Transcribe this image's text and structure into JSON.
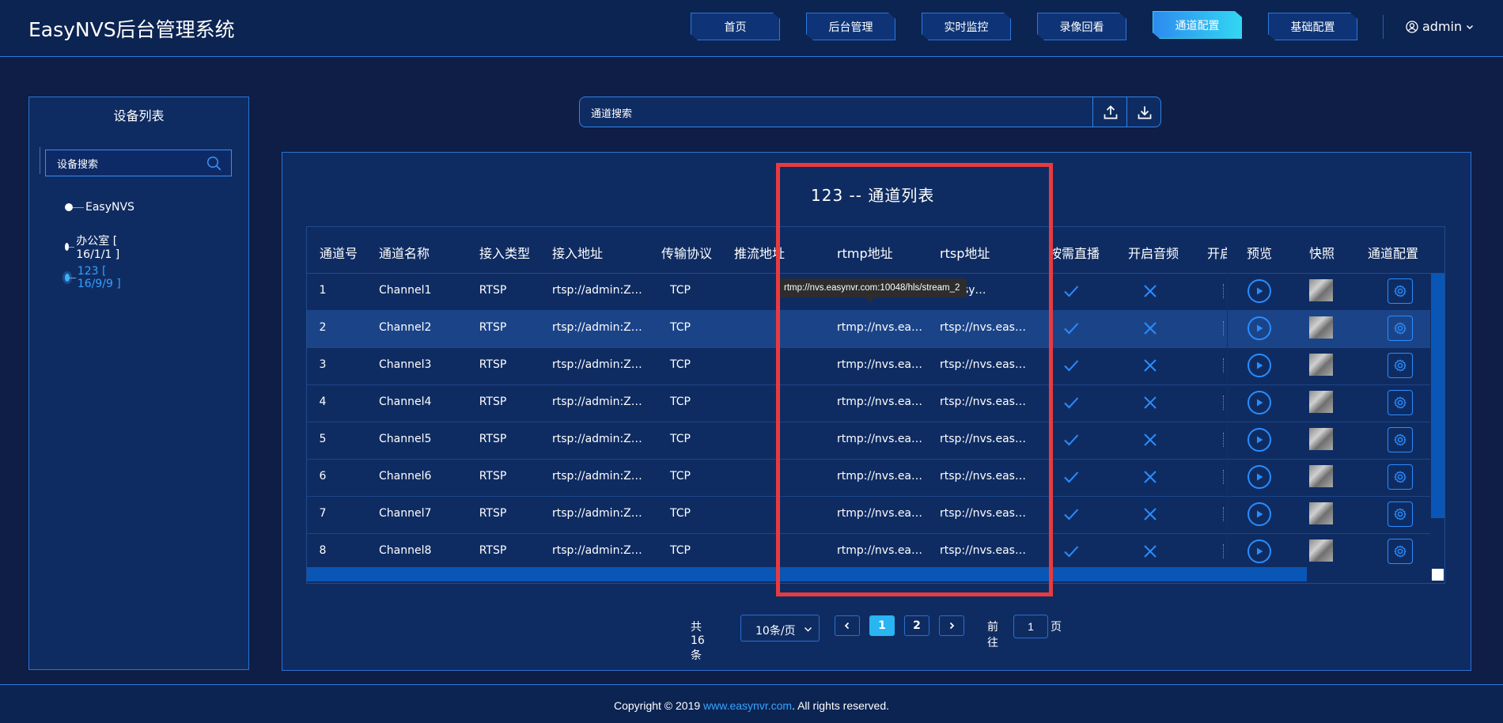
{
  "header": {
    "app_title": "EasyNVS后台管理系统",
    "nav": [
      {
        "label": "首页"
      },
      {
        "label": "后台管理"
      },
      {
        "label": "实时监控"
      },
      {
        "label": "录像回看"
      },
      {
        "label": "通道配置",
        "active": true
      },
      {
        "label": "基础配置"
      }
    ],
    "user": "admin"
  },
  "sidebar": {
    "title": "设备列表",
    "search_placeholder": "设备搜索",
    "tree": [
      {
        "label": "EasyNVS"
      },
      {
        "label": "办公室 [ 16/1/1 ]"
      },
      {
        "label": "123 [ 16/9/9 ]",
        "active": true
      }
    ]
  },
  "channel_search": {
    "placeholder": "通道搜索"
  },
  "list": {
    "title": "123 -- 通道列表",
    "columns": [
      "通道号",
      "通道名称",
      "接入类型",
      "接入地址",
      "传输协议",
      "推流地址",
      "rtmp地址",
      "rtsp地址",
      "按需直播",
      "开启音频",
      "开启",
      "预览",
      "快照",
      "通道配置"
    ],
    "rows": [
      {
        "no": "1",
        "name": "Channel1",
        "type": "RTSP",
        "addr": "rtsp://admin:ZH…",
        "proto": "TCP",
        "push": "",
        "rtmp": "",
        "rtsp": "s.easy…"
      },
      {
        "no": "2",
        "name": "Channel2",
        "type": "RTSP",
        "addr": "rtsp://admin:ZH…",
        "proto": "TCP",
        "push": "",
        "rtmp": "rtmp://nvs.easy…",
        "rtsp": "rtsp://nvs.easy…"
      },
      {
        "no": "3",
        "name": "Channel3",
        "type": "RTSP",
        "addr": "rtsp://admin:ZH…",
        "proto": "TCP",
        "push": "",
        "rtmp": "rtmp://nvs.easy…",
        "rtsp": "rtsp://nvs.easy…"
      },
      {
        "no": "4",
        "name": "Channel4",
        "type": "RTSP",
        "addr": "rtsp://admin:ZH…",
        "proto": "TCP",
        "push": "",
        "rtmp": "rtmp://nvs.easy…",
        "rtsp": "rtsp://nvs.easy…"
      },
      {
        "no": "5",
        "name": "Channel5",
        "type": "RTSP",
        "addr": "rtsp://admin:ZH…",
        "proto": "TCP",
        "push": "",
        "rtmp": "rtmp://nvs.easy…",
        "rtsp": "rtsp://nvs.easy…"
      },
      {
        "no": "6",
        "name": "Channel6",
        "type": "RTSP",
        "addr": "rtsp://admin:ZH…",
        "proto": "TCP",
        "push": "",
        "rtmp": "rtmp://nvs.easy…",
        "rtsp": "rtsp://nvs.easy…"
      },
      {
        "no": "7",
        "name": "Channel7",
        "type": "RTSP",
        "addr": "rtsp://admin:ZH…",
        "proto": "TCP",
        "push": "",
        "rtmp": "rtmp://nvs.easy…",
        "rtsp": "rtsp://nvs.easy…"
      },
      {
        "no": "8",
        "name": "Channel8",
        "type": "RTSP",
        "addr": "rtsp://admin:ZH…",
        "proto": "TCP",
        "push": "",
        "rtmp": "rtmp://nvs.easy…",
        "rtsp": "rtsp://nvs.easy…"
      }
    ],
    "tooltip": "rtmp://nvs.easynvr.com:10048/hls/stream_2"
  },
  "pagination": {
    "total": "共 16 条",
    "page_size": "10条/页",
    "pages": [
      "1",
      "2"
    ],
    "goto_label": "前往",
    "goto_value": "1",
    "goto_suffix": "页"
  },
  "footer": {
    "prefix": "Copyright © 2019 ",
    "link": "www.easynvr.com",
    "suffix": ". All rights reserved."
  },
  "colors": {
    "accent": "#2a8cff",
    "active_tab": "#33d6f3",
    "highlight_box": "#e93a3f"
  }
}
